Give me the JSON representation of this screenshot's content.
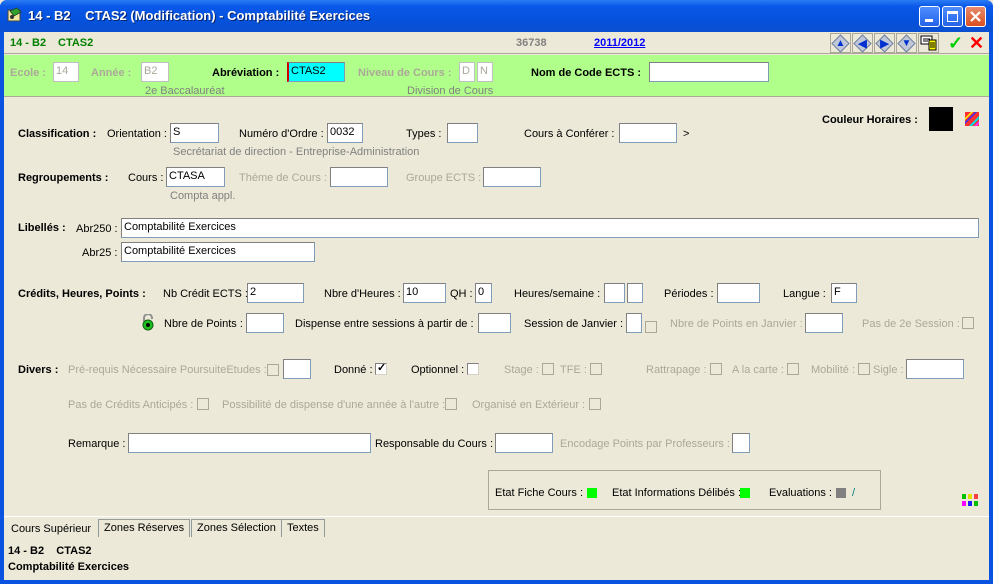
{
  "window": {
    "title": "14 - B2    CTAS2 (Modification) - Comptabilité Exercices",
    "controls": [
      "minimize",
      "maximize",
      "close"
    ]
  },
  "topbar": {
    "code": "14 - B2",
    "abbr": "CTAS2",
    "record_id": "36738",
    "year_link": "2011/2012",
    "nav_buttons": [
      "arrow-up",
      "arrow-left",
      "arrow-right",
      "arrow-down",
      "document-list"
    ],
    "confirm_icon": "✓",
    "cancel_icon": "✕"
  },
  "header": {
    "ecole_label": "Ecole :",
    "ecole_value": "14",
    "annee_label": "Année :",
    "annee_value": "B2",
    "annee_desc": "2e Baccalauréat",
    "abreviation_label": "Abréviation :",
    "abreviation_value": "CTAS2",
    "niveau_label": "Niveau de Cours :",
    "niveau_value1": "D",
    "niveau_value2": "N",
    "niveau_desc": "Division de Cours",
    "ects_label": "Nom de Code ECTS :",
    "ects_value": ""
  },
  "classification": {
    "section_label": "Classification :",
    "orientation_label": "Orientation :",
    "orientation_value": "S",
    "orientation_desc": "Secrétariat de direction - Entreprise-Administration",
    "numero_label": "Numéro d'Ordre :",
    "numero_value": "0032",
    "types_label": "Types :",
    "types_value": "",
    "conferer_label": "Cours à Conférer :",
    "conferer_value": "",
    "conferer_arrow": ">",
    "couleur_label": "Couleur Horaires :",
    "couleur_value": "#000000"
  },
  "regroupements": {
    "section_label": "Regroupements :",
    "cours_label": "Cours :",
    "cours_value": "CTASA",
    "cours_desc": "Compta appl.",
    "theme_label": "Thème de Cours :",
    "theme_value": "",
    "groupe_label": "Groupe ECTS :",
    "groupe_value": ""
  },
  "libelles": {
    "section_label": "Libellés :",
    "abr250_label": "Abr250 :",
    "abr250_value": "Comptabilité Exercices",
    "abr25_label": "Abr25 :",
    "abr25_value": "Comptabilité Exercices"
  },
  "credits": {
    "section_label": "Crédits, Heures, Points :",
    "ects_label": "Nb Crédit ECTS :",
    "ects_value": "2",
    "heures_label": "Nbre d'Heures :",
    "heures_value": "10",
    "qh_label": "QH :",
    "qh_value": "0",
    "hsem_label": "Heures/semaine :",
    "hsem_value1": "",
    "hsem_value2": "",
    "periodes_label": "Périodes :",
    "periodes_value": "",
    "langue_label": "Langue :",
    "langue_value": "F",
    "points_label": "Nbre de Points :",
    "points_value": "",
    "dispense_label": "Dispense entre sessions à partir de :",
    "dispense_value": "",
    "janvier_label": "Session de Janvier :",
    "janvier_value": "",
    "janvier_checked": false,
    "points_janvier_label": "Nbre de Points en Janvier :",
    "points_janvier_value": "",
    "pas2e_label": "Pas de 2e Session :",
    "pas2e_checked": false
  },
  "divers": {
    "section_label": "Divers :",
    "prerequis_label": "Pré-requis Nécessaire PoursuiteEtudes :",
    "prerequis_checked": false,
    "prerequis_value": "",
    "donne_label": "Donné :",
    "donne_checked": true,
    "optionnel_label": "Optionnel :",
    "optionnel_checked": false,
    "stage_label": "Stage :",
    "stage_checked": false,
    "tfe_label": "TFE :",
    "tfe_checked": false,
    "rattrapage_label": "Rattrapage :",
    "rattrapage_checked": false,
    "carte_label": "A la carte :",
    "carte_checked": false,
    "mobilite_label": "Mobilité :",
    "mobilite_checked": false,
    "sigle_label": "Sigle :",
    "sigle_value": "",
    "anticipes_label": "Pas de Crédits Anticipés :",
    "anticipes_checked": false,
    "possibilite_label": "Possibilité de dispense d'une année à l'autre :",
    "possibilite_checked": false,
    "exterieur_label": "Organisé en Extérieur :",
    "exterieur_checked": false
  },
  "remarques": {
    "remarque_label": "Remarque :",
    "remarque_value": "",
    "responsable_label": "Responsable du Cours :",
    "responsable_value": "",
    "encodage_label": "Encodage Points par Professeurs :",
    "encodage_value": ""
  },
  "status": {
    "fiche_label": "Etat Fiche Cours :",
    "fiche_color": "#00ff00",
    "delib_label": "Etat Informations Délibés :",
    "delib_color": "#00ff00",
    "eval_label": "Evaluations :",
    "eval_color": "#808080",
    "eval_suffix": "/"
  },
  "tabs": [
    "Cours Supérieur",
    "Zones Réserves",
    "Zones Sélection",
    "Textes"
  ],
  "active_tab": 0,
  "footer": {
    "line1": "14 - B2    CTAS2",
    "line2": "Comptabilité Exercices"
  }
}
